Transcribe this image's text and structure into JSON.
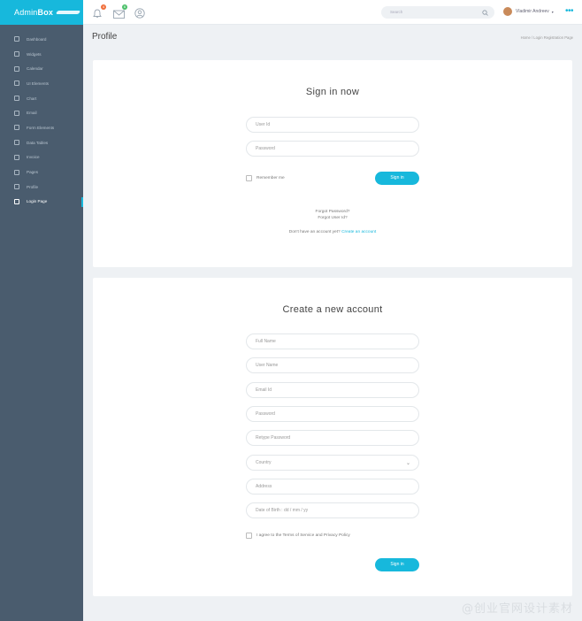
{
  "brand": {
    "name_a": "Admin",
    "name_b": "Box"
  },
  "sidebar": {
    "items": [
      {
        "label": "Dashboard"
      },
      {
        "label": "Widgets"
      },
      {
        "label": "Calendar"
      },
      {
        "label": "UI Elements"
      },
      {
        "label": "Chart"
      },
      {
        "label": "Email"
      },
      {
        "label": "Form Elements"
      },
      {
        "label": "Data Tables"
      },
      {
        "label": "Invoice"
      },
      {
        "label": "Pages"
      },
      {
        "label": "Profile"
      },
      {
        "label": "Login Page"
      }
    ],
    "active_index": 11
  },
  "topbar": {
    "notify_count": "4",
    "mail_count": "6",
    "search_placeholder": "Search",
    "user_name": "Vladimir Andreev",
    "caret": "▾",
    "more": "•••"
  },
  "page": {
    "title": "Profile",
    "breadcrumb": "Home / Login Registration Page"
  },
  "signin": {
    "title": "Sign in now",
    "user_placeholder": "User Id",
    "password_placeholder": "Password",
    "remember": "Remember me",
    "button": "Sign in",
    "forgot_password": "Forgot Password?",
    "forgot_user": "Forgot User Id?",
    "no_account": "Don't have an account yet?",
    "create_link": "Create an account"
  },
  "register": {
    "title": "Create a new account",
    "full_name": "Full Name",
    "user_name": "User Name",
    "email": "Email Id",
    "password": "Password",
    "retype_password": "Retype Password",
    "country": "Country",
    "address": "Address",
    "dob": "Date of Birth : dd / mm / yy",
    "agree": "I agree to the Terms of Service and Privacy Policy",
    "button": "Sign in"
  },
  "colors": {
    "accent": "#17b8dc",
    "sidebar": "#4a5c6e",
    "notify_badge": "#f0703c",
    "mail_badge": "#4cc06a"
  },
  "watermark": "@创业官网设计素材"
}
